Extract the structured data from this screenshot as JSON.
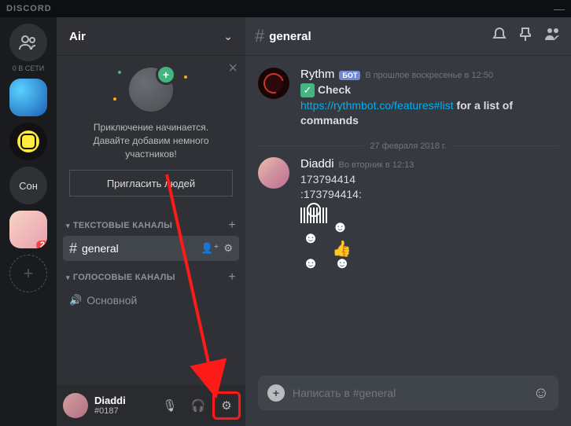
{
  "titlebar": {
    "logo": "DISCORD"
  },
  "servers": {
    "online_label": "0 В СЕТИ",
    "text_server_2": "Сон",
    "badge_count": "2"
  },
  "sidebar": {
    "server_name": "Air",
    "invite": {
      "line1": "Приключение начинается.",
      "line2": "Давайте добавим немного",
      "line3": "участников!",
      "button": "Пригласить людей"
    },
    "categories": {
      "text": {
        "label": "ТЕКСТОВЫЕ КАНАЛЫ"
      },
      "voice": {
        "label": "ГОЛОСОВЫЕ КАНАЛЫ"
      }
    },
    "channels": {
      "general": "general",
      "main_voice": "Основной"
    }
  },
  "user": {
    "name": "Diaddi",
    "tag": "#0187"
  },
  "chat": {
    "channel_name": "general",
    "compose_placeholder": "Написать в #general",
    "divider_date": "27 февраля 2018 г.",
    "messages": {
      "m1": {
        "author": "Rythm",
        "bot": "БОТ",
        "time": "В прошлое воскресенье в 12:50",
        "check_text": "Check",
        "link": "https://rythmbot.co/features#list",
        "after_link": " for a list of commands"
      },
      "m2": {
        "author": "Diaddi",
        "time": "Во вторник в 12:13",
        "line1": "173794414",
        "line2": ":173794414:"
      }
    }
  }
}
